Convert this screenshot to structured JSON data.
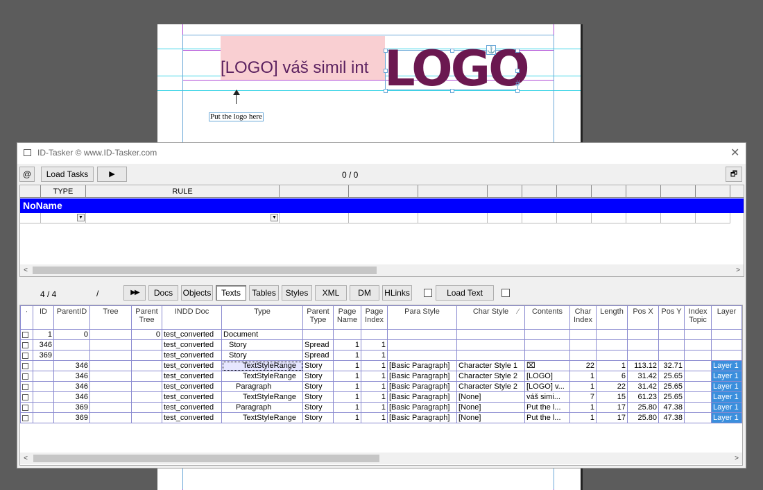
{
  "document": {
    "logo_text": "[LOGO] váš simil int",
    "logo_graphic": "LOGO",
    "caption": "Put the logo here",
    "hash_mark": "#",
    "anchor_glyph": "⚓"
  },
  "window": {
    "title": "ID-Tasker  © www.ID-Tasker.com",
    "close_label": "✕",
    "toolbar": {
      "at_label": "@",
      "load_tasks_label": "Load Tasks",
      "play_label": "▶",
      "counter": "0 / 0",
      "restore_label": "🗗"
    },
    "rule_grid": {
      "headers": [
        "",
        "TYPE",
        "RULE",
        "",
        "",
        "",
        "",
        "",
        "",
        "",
        "",
        "",
        ""
      ],
      "group_name": "NoName",
      "dropdown_glyph": "▼"
    },
    "tasks_toolbar": {
      "counter": "4 / 4",
      "slash": "/",
      "fast_forward_label": "▶▶",
      "tabs": [
        "Docs",
        "Objects",
        "Texts",
        "Tables",
        "Styles",
        "XML",
        "DM",
        "HLinks"
      ],
      "active_tab": "Texts",
      "load_text_label": "Load Text"
    },
    "scroll_left": "<",
    "scroll_right": ">",
    "table": {
      "columns": [
        "·",
        "ID",
        "ParentID",
        "Tree",
        "Parent Tree",
        "INDD Doc",
        "Type",
        "Parent Type",
        "Page Name",
        "Page Index",
        "Para Style",
        "Char Style",
        "Contents",
        "Char Index",
        "Length",
        "Pos X",
        "Pos Y",
        "Index Topic",
        "Layer"
      ],
      "sort_indicator": "⁄",
      "rows": [
        [
          "",
          "1",
          "0",
          "",
          "0",
          "test_converted",
          "Document",
          "",
          "",
          "",
          "",
          "",
          "",
          "",
          "",
          "",
          "",
          "",
          ""
        ],
        [
          "",
          "346",
          "",
          "",
          "",
          "test_converted",
          "Story",
          "Spread",
          "1",
          "1",
          "",
          "",
          "",
          "",
          "",
          "",
          "",
          "",
          ""
        ],
        [
          "",
          "369",
          "",
          "",
          "",
          "test_converted",
          "Story",
          "Spread",
          "1",
          "1",
          "",
          "",
          "",
          "",
          "",
          "",
          "",
          "",
          ""
        ],
        [
          "",
          "",
          "346",
          "",
          "",
          "test_converted",
          "TextStyleRange",
          "Story",
          "1",
          "1",
          "[Basic Paragraph]",
          "Character Style 1",
          "⌧",
          "22",
          "1",
          "113.12",
          "32.71",
          "",
          "Layer 1"
        ],
        [
          "",
          "",
          "346",
          "",
          "",
          "test_converted",
          "TextStyleRange",
          "Story",
          "1",
          "1",
          "[Basic Paragraph]",
          "Character Style 2",
          "[LOGO]",
          "1",
          "6",
          "31.42",
          "25.65",
          "",
          "Layer 1"
        ],
        [
          "",
          "",
          "346",
          "",
          "",
          "test_converted",
          "Paragraph",
          "Story",
          "1",
          "1",
          "[Basic Paragraph]",
          "Character Style 2",
          "[LOGO] v...",
          "1",
          "22",
          "31.42",
          "25.65",
          "",
          "Layer 1"
        ],
        [
          "",
          "",
          "346",
          "",
          "",
          "test_converted",
          "TextStyleRange",
          "Story",
          "1",
          "1",
          "[Basic Paragraph]",
          "[None]",
          " váš simi...",
          "7",
          "15",
          "61.23",
          "25.65",
          "",
          "Layer 1"
        ],
        [
          "",
          "",
          "369",
          "",
          "",
          "test_converted",
          "Paragraph",
          "Story",
          "1",
          "1",
          "[Basic Paragraph]",
          "[None]",
          "Put the l...",
          "1",
          "17",
          "25.80",
          "47.38",
          "",
          "Layer 1"
        ],
        [
          "",
          "",
          "369",
          "",
          "",
          "test_converted",
          "TextStyleRange",
          "Story",
          "1",
          "1",
          "[Basic Paragraph]",
          "[None]",
          "Put the l...",
          "1",
          "17",
          "25.80",
          "47.38",
          "",
          "Layer 1"
        ]
      ]
    }
  }
}
